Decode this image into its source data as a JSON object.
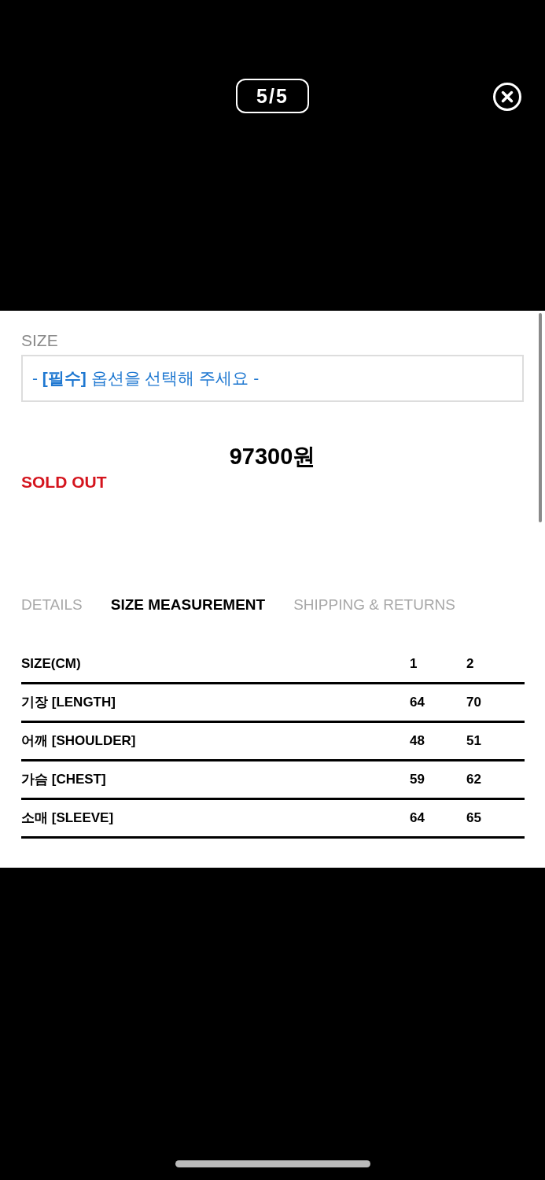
{
  "viewer": {
    "counter": "5/5"
  },
  "product": {
    "option_label": "SIZE",
    "option_select": {
      "value": "- **[필수]** 옵션을 선택해 주세요 -"
    },
    "price": "97300원",
    "sold_out": true,
    "sold_out_text": "SOLD OUT"
  },
  "tabs": [
    {
      "label": "DETAILS",
      "selected": false
    },
    {
      "label": "SIZE MEASUREMENT",
      "selected": true
    },
    {
      "label": "SHIPPING & RETURNS",
      "selected": false
    }
  ],
  "size_table": {
    "columns": [
      "SIZE(CM)",
      "1",
      "2"
    ],
    "rows": [
      [
        "기장 [LENGTH]",
        "64",
        "70"
      ],
      [
        "어깨 [SHOULDER]",
        "48",
        "51"
      ],
      [
        "가슴 [CHEST]",
        "59",
        "62"
      ],
      [
        "소매 [SLEEVE]",
        "64",
        "65"
      ]
    ]
  }
}
